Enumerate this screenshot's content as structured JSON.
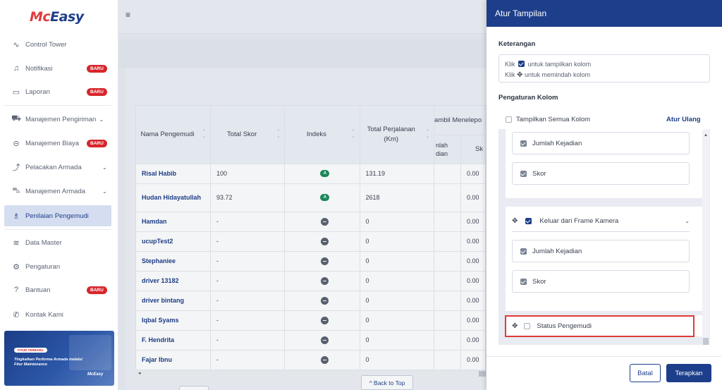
{
  "brand": {
    "logo_part1": "Mc",
    "logo_part2": "Easy"
  },
  "sidebar": {
    "items": [
      {
        "label": "Control Tower",
        "icon": "pulse-icon"
      },
      {
        "label": "Notifikasi",
        "icon": "bell-icon",
        "badge": "BARU"
      },
      {
        "label": "Laporan",
        "icon": "report-icon",
        "badge": "BARU"
      },
      {
        "label": "Manajemen Pengiriman",
        "icon": "truck-icon",
        "chevron": "⌄"
      },
      {
        "label": "Manajemen Biaya",
        "icon": "cost-icon",
        "badge": "BARU"
      },
      {
        "label": "Pelacakan Armada",
        "icon": "route-icon",
        "chevron": "⌄"
      },
      {
        "label": "Manajemen Armada",
        "icon": "fleet-icon",
        "chevron": "⌄"
      },
      {
        "label": "Penilaian Pengemudi",
        "icon": "driver-icon"
      },
      {
        "label": "Data Master",
        "icon": "database-icon"
      },
      {
        "label": "Pengaturan",
        "icon": "gear-icon"
      },
      {
        "label": "Bantuan",
        "icon": "help-icon",
        "badge": "BARU"
      },
      {
        "label": "Kontak Kami",
        "icon": "phone-icon"
      }
    ],
    "promo": {
      "tag": "FITUR TERBARU",
      "text": "Tingkatkan Performa Armada melalui Fitur Maintenance",
      "logo": "McEasy"
    }
  },
  "table": {
    "headers": {
      "name": "Nama Pengemudi",
      "score": "Total Skor",
      "index": "Indeks",
      "trips": "Total Perjalanan (Km)",
      "group": "ambil Menelepo",
      "sub1": "nlah dian",
      "sub2": "Sk"
    },
    "rows": [
      {
        "name": "Risal Habib",
        "score": "100",
        "index": "A",
        "trips": "131.19",
        "c6": "0.00"
      },
      {
        "name": "Hudan Hidayatullah",
        "score": "93.72",
        "index": "A",
        "trips": "2618",
        "c6": "0.00"
      },
      {
        "name": "Hamdan",
        "score": "-",
        "index": "",
        "trips": "0",
        "c6": "0.00"
      },
      {
        "name": "ucupTest2",
        "score": "-",
        "index": "",
        "trips": "0",
        "c6": "0.00"
      },
      {
        "name": "Stephaniee",
        "score": "-",
        "index": "",
        "trips": "0",
        "c6": "0.00"
      },
      {
        "name": "driver 13182",
        "score": "-",
        "index": "",
        "trips": "0",
        "c6": "0.00"
      },
      {
        "name": "driver bintang",
        "score": "-",
        "index": "",
        "trips": "0",
        "c6": "0.00"
      },
      {
        "name": "Iqbal Syams",
        "score": "-",
        "index": "",
        "trips": "0",
        "c6": "0.00"
      },
      {
        "name": "F. Hendrita",
        "score": "-",
        "index": "",
        "trips": "0",
        "c6": "0.00"
      },
      {
        "name": "Fajar Ibnu",
        "score": "-",
        "index": "",
        "trips": "0",
        "c6": "0.00"
      }
    ]
  },
  "back_to_top": "^ Back to Top",
  "panel": {
    "title": "Atur Tampilan",
    "keterangan_title": "Keterangan",
    "ket_line1_a": "Klik",
    "ket_line1_b": "untuk tampilkan kolom",
    "ket_line2_a": "Klik",
    "ket_line2_b": "untuk memindah kolom",
    "pengaturan_title": "Pengaturan Kolom",
    "show_all": "Tampilkan Semua Kolom",
    "reset": "Atur Ulang",
    "group1": {
      "items": [
        "Jumlah Kejadian",
        "Skor"
      ]
    },
    "group2": {
      "label": "Keluar dari Frame Kamera",
      "items": [
        "Jumlah Kejadian",
        "Skor"
      ]
    },
    "status": "Status Pengemudi",
    "cancel": "Batal",
    "apply": "Terapkan"
  },
  "colors": {
    "primary": "#1d3e8a",
    "badge": "#d8262c",
    "highlight": "#e03a3a",
    "index_a": "#1b8a5a"
  }
}
